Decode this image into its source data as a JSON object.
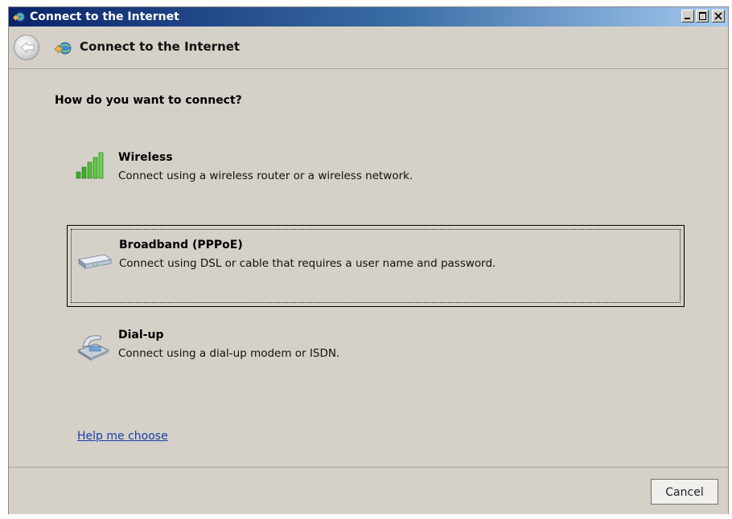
{
  "window": {
    "title": "Connect to the Internet",
    "controls": [
      "minimize-icon",
      "maximize-icon",
      "close-icon"
    ]
  },
  "nav": {
    "title": "Connect to the Internet",
    "back_icon": "back-arrow-icon",
    "page_icon": "network-globe-icon"
  },
  "main": {
    "question": "How do you want to connect?",
    "options": [
      {
        "icon": "wireless-signal-icon",
        "title": "Wireless",
        "description": "Connect using a wireless router or a wireless network."
      },
      {
        "icon": "broadband-modem-icon",
        "title": "Broadband (PPPoE)",
        "description": "Connect using DSL or cable that requires a user name and password.",
        "selected": true
      },
      {
        "icon": "dialup-phone-icon",
        "title": "Dial-up",
        "description": "Connect using a dial-up modem or ISDN."
      }
    ],
    "help_link": "Help me choose"
  },
  "footer": {
    "cancel_label": "Cancel"
  },
  "colors": {
    "titlebar_start": "#0a246a",
    "titlebar_end": "#a6caf0",
    "background": "#d5d1c9",
    "link": "#1a3ea8",
    "wireless_green": "#3fae2a"
  }
}
